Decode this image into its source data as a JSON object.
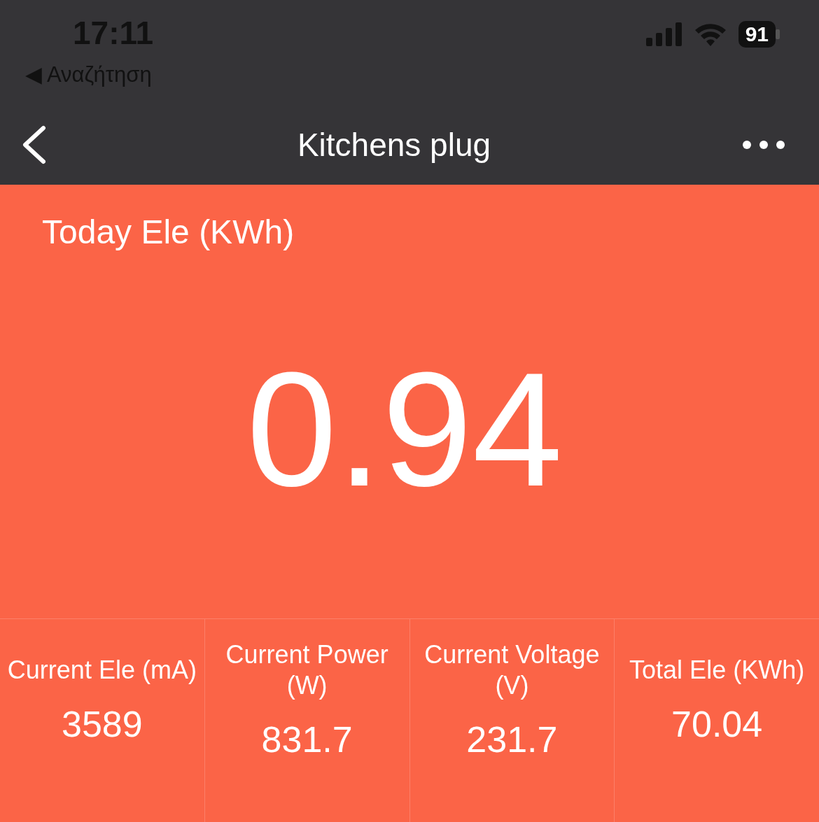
{
  "status_bar": {
    "time": "17:11",
    "back_app": "◀ Αναζήτηση",
    "battery": "91"
  },
  "nav": {
    "title": "Kitchens plug"
  },
  "today": {
    "label": "Today Ele (KWh)",
    "value": "0.94"
  },
  "metrics": [
    {
      "label": "Current Ele (mA)",
      "value": "3589"
    },
    {
      "label": "Current Power (W)",
      "value": "831.7"
    },
    {
      "label": "Current Voltage (V)",
      "value": "231.7"
    },
    {
      "label": "Total Ele (KWh)",
      "value": "70.04"
    }
  ]
}
